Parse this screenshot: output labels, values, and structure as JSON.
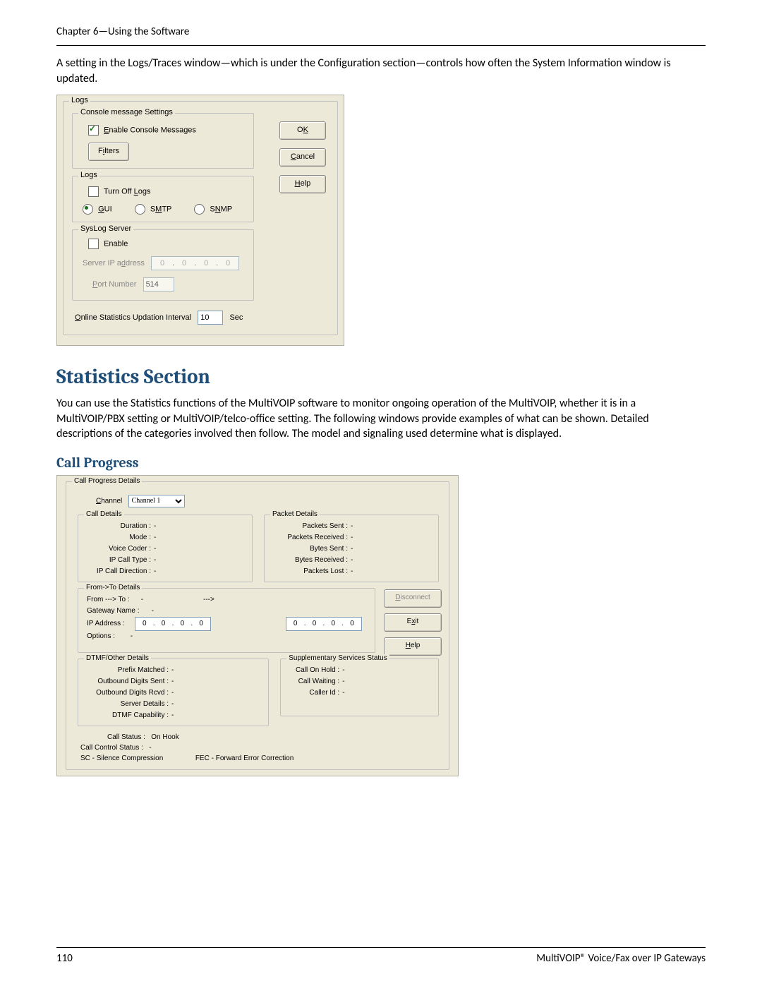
{
  "chapter_header": "Chapter 6—Using the Software",
  "intro_paragraph": "A setting in the Logs/Traces window—which is under the Configuration section—controls how often the System Information window is updated.",
  "logs_dialog": {
    "outer_legend": "Logs",
    "console_group": {
      "legend": "Console message Settings",
      "enable_label_prefix": "E",
      "enable_label_rest": "nable Console Messages",
      "enable_checked": true,
      "filters_btn_prefix": "F",
      "filters_btn_u": "i",
      "filters_btn_rest": "lters"
    },
    "buttons": {
      "ok_pre": "O",
      "ok_u": "K",
      "cancel_u": "C",
      "cancel_rest": "ancel",
      "help_u": "H",
      "help_rest": "elp"
    },
    "logs_group": {
      "legend": "Logs",
      "turn_off_label": "Turn Off Logs",
      "turn_off_u": "L",
      "radios": {
        "gui": {
          "u": "G",
          "rest": "UI",
          "selected": true
        },
        "smtp": {
          "pre": "S",
          "u": "M",
          "rest": "TP",
          "selected": false
        },
        "snmp": {
          "pre": "S",
          "u": "N",
          "rest": "MP",
          "selected": false
        }
      }
    },
    "syslog_group": {
      "legend": "SysLog Server",
      "enable_label": "Enable",
      "server_ip_label_pre": "Server IP a",
      "server_ip_label_u": "d",
      "server_ip_label_rest": "dress",
      "server_ip": [
        "0",
        "0",
        "0",
        "0"
      ],
      "port_label_u": "P",
      "port_label_rest": "ort Number",
      "port_value": "514"
    },
    "update_interval_label_u": "O",
    "update_interval_label_rest": "nline Statistics Updation Interval",
    "update_interval_value": "10",
    "update_interval_unit": "Sec"
  },
  "statistics_heading": "Statistics Section",
  "statistics_paragraph": "You can use the Statistics functions of the MultiVOIP software to monitor ongoing operation of the MultiVOIP, whether it is in a MultiVOIP/PBX setting or MultiVOIP/telco-office setting. The following windows provide examples of what can be shown. Detailed descriptions of the categories involved then follow. The model and signaling used determine what is displayed.",
  "call_progress_heading": "Call Progress",
  "cp": {
    "outer_legend": "Call Progress Details",
    "channel_label_u": "C",
    "channel_label_rest": "hannel",
    "channel_value": "Channel 1",
    "call_details": {
      "legend": "Call Details",
      "rows": [
        {
          "label": "Duration :",
          "value": "-"
        },
        {
          "label": "Mode :",
          "value": "-"
        },
        {
          "label": "Voice Coder :",
          "value": "-"
        },
        {
          "label": "IP Call Type :",
          "value": "-"
        },
        {
          "label": "IP Call Direction :",
          "value": "-"
        }
      ]
    },
    "packet_details": {
      "legend": "Packet Details",
      "rows": [
        {
          "label": "Packets Sent :",
          "value": "-"
        },
        {
          "label": "Packets Received :",
          "value": "-"
        },
        {
          "label": "Bytes Sent :",
          "value": "-"
        },
        {
          "label": "Bytes Received :",
          "value": "-"
        },
        {
          "label": "Packets Lost :",
          "value": "-"
        }
      ]
    },
    "fromto": {
      "legend": "From->To Details",
      "from_to_label": "From ---> To :",
      "from_to_value": "-",
      "arrow": "--->",
      "gateway_label": "Gateway Name :",
      "gateway_value": "-",
      "ip_label": "IP Address :",
      "ip_left": [
        "0",
        "0",
        "0",
        "0"
      ],
      "ip_right": [
        "0",
        "0",
        "0",
        "0"
      ],
      "options_label": "Options :",
      "options_value": "-"
    },
    "side_buttons": {
      "disconnect": {
        "u": "D",
        "rest": "isconnect",
        "disabled": true
      },
      "exit": {
        "pre": "E",
        "u": "x",
        "rest": "it"
      },
      "help": {
        "u": "H",
        "rest": "elp"
      }
    },
    "dtmf": {
      "legend": "DTMF/Other Details",
      "rows": [
        {
          "label": "Prefix Matched :",
          "value": "-"
        },
        {
          "label": "Outbound Digits Sent :",
          "value": "-"
        },
        {
          "label": "Outbound Digits Rcvd :",
          "value": "-"
        },
        {
          "label": "Server Details :",
          "value": "-"
        },
        {
          "label": "DTMF Capability :",
          "value": "-"
        }
      ]
    },
    "supp": {
      "legend": "Supplementary Services Status",
      "rows": [
        {
          "label": "Call On Hold :",
          "value": "-"
        },
        {
          "label": "Call Waiting :",
          "value": "-"
        },
        {
          "label": "Caller Id :",
          "value": "-"
        }
      ]
    },
    "footer": {
      "call_status_label": "Call Status :",
      "call_status_value": "On Hook",
      "call_control_label": "Call Control Status :",
      "call_control_value": "-",
      "sc_note": "SC - Silence Compression",
      "fec_note": "FEC - Forward Error Correction"
    }
  },
  "page_number": "110",
  "footer_text": "MultiVOIP® Voice/Fax over IP Gateways"
}
